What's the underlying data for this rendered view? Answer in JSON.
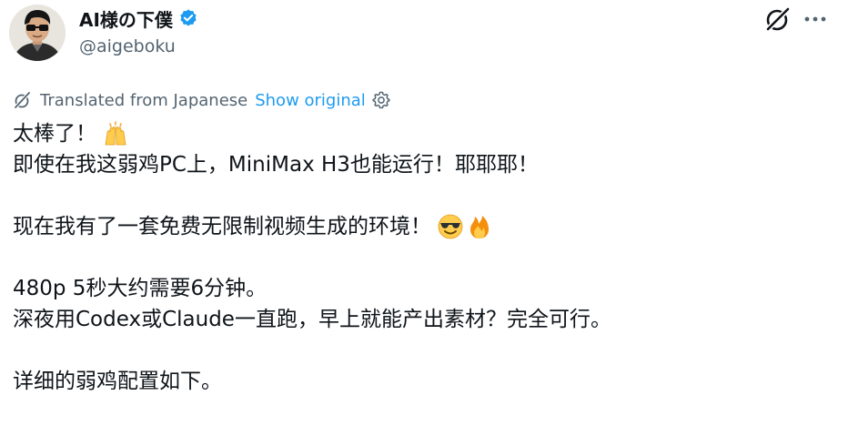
{
  "author": {
    "display_name": "AI様の下僕",
    "handle": "@aigeboku",
    "verified": true
  },
  "header_actions": {
    "grok_icon": "grok-icon",
    "more_icon": "more-horizontal-icon"
  },
  "translation": {
    "notice": "Translated from Japanese",
    "show_original": "Show original"
  },
  "tweet": {
    "line1": "太棒了！",
    "line2": "即使在我这弱鸡PC上，MiniMax H3也能运行！耶耶耶！",
    "line3": "现在我有了一套免费无限制视频生成的环境！",
    "line4": "480p 5秒大约需要6分钟。",
    "line5": "深夜用Codex或Claude一直跑，早上就能产出素材？完全可行。",
    "line6": "详细的弱鸡配置如下。"
  },
  "colors": {
    "text": "#0f1419",
    "secondary": "#536471",
    "link": "#1d9bf0",
    "verified": "#1d9bf0"
  }
}
